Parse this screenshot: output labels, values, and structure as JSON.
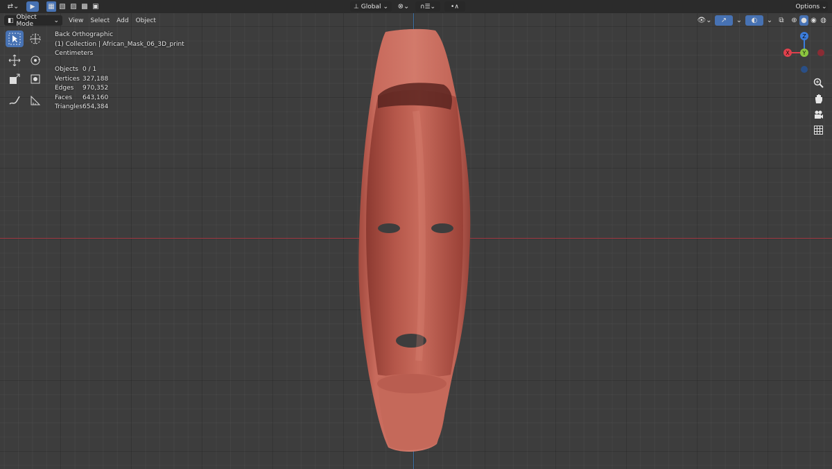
{
  "header": {
    "transform_orientation": "Global",
    "options_label": "Options",
    "mode_label": "Object Mode",
    "menus": [
      "View",
      "Select",
      "Add",
      "Object"
    ]
  },
  "overlay": {
    "view_name": "Back Orthographic",
    "collection": "(1) Collection | African_Mask_06_3D_print",
    "units": "Centimeters"
  },
  "stats": [
    {
      "label": "Objects",
      "value": "0 / 1"
    },
    {
      "label": "Vertices",
      "value": "327,188"
    },
    {
      "label": "Edges",
      "value": "970,352"
    },
    {
      "label": "Faces",
      "value": "643,160"
    },
    {
      "label": "Triangles",
      "value": "654,384"
    }
  ],
  "gizmo": {
    "z": "Z",
    "x": "X",
    "y": "Y"
  },
  "colors": {
    "active_blue": "#4772b3",
    "mask_red": "#c4675a",
    "x_axis": "#a23a44",
    "z_axis": "#3c6fa3"
  },
  "icons": {
    "editor_type": "transform-gizmo-icon",
    "select_box": "cursor-icon",
    "viewport_shading": [
      "wireframe-icon",
      "solid-icon",
      "material-icon",
      "rendered-icon"
    ]
  }
}
